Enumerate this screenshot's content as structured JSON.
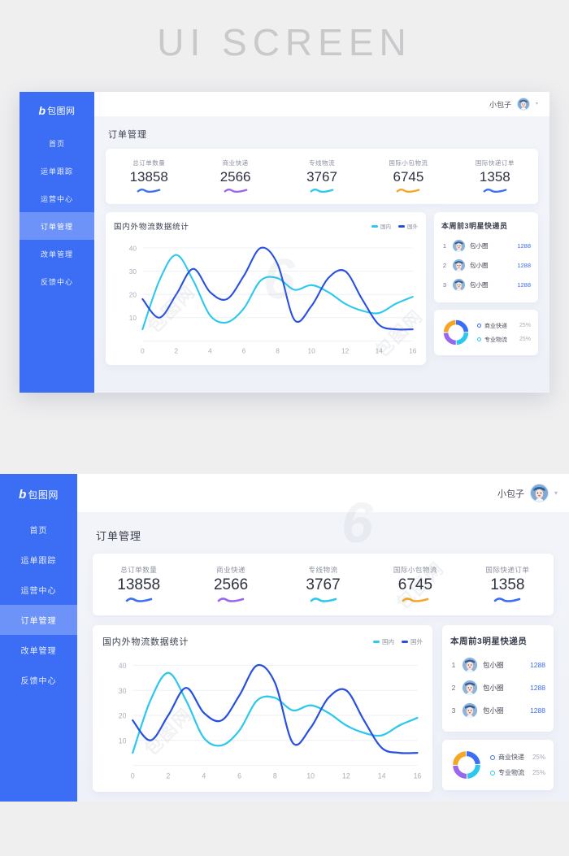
{
  "banner": {
    "text": "UI SCREEN"
  },
  "brand": {
    "mark": "b",
    "name": "包图网"
  },
  "sidebar": {
    "items": [
      {
        "label": "首页",
        "active": false
      },
      {
        "label": "运单跟踪",
        "active": false
      },
      {
        "label": "运营中心",
        "active": false
      },
      {
        "label": "订单管理",
        "active": true
      },
      {
        "label": "改单管理",
        "active": false
      },
      {
        "label": "反馈中心",
        "active": false
      }
    ]
  },
  "topbar": {
    "user_name": "小包子",
    "caret": "▾"
  },
  "page": {
    "title": "订单管理"
  },
  "stats": [
    {
      "label": "总订单数量",
      "value": "13858",
      "color": "#3b6ef5"
    },
    {
      "label": "商业快递",
      "value": "2566",
      "color": "#9966ee"
    },
    {
      "label": "专线物流",
      "value": "3767",
      "color": "#2cc8ee"
    },
    {
      "label": "国际小包物流",
      "value": "6745",
      "color": "#f5a623"
    },
    {
      "label": "国际快递订单",
      "value": "1358",
      "color": "#3b6ef5"
    }
  ],
  "chart_card": {
    "title": "国内外物流数据统计",
    "legend": [
      {
        "label": "国内",
        "color": "#2cc8ee"
      },
      {
        "label": "国外",
        "color": "#2850e0"
      }
    ]
  },
  "chart_data": {
    "type": "line",
    "title": "国内外物流数据统计",
    "xlabel": "",
    "ylabel": "",
    "xlim": [
      0,
      16
    ],
    "ylim": [
      0,
      44
    ],
    "x_ticks": [
      0,
      2,
      4,
      6,
      8,
      10,
      12,
      14,
      16
    ],
    "y_ticks": [
      10,
      20,
      30,
      40
    ],
    "grid": true,
    "legend_position": "top-right",
    "x": [
      0,
      1,
      2,
      3,
      4,
      5,
      6,
      7,
      8,
      9,
      10,
      11,
      12,
      13,
      14,
      15,
      16
    ],
    "series": [
      {
        "name": "国内",
        "color": "#2cc8ee",
        "values": [
          5,
          26,
          37,
          26,
          11,
          8,
          14,
          26,
          27,
          22,
          24,
          21,
          16,
          13,
          12,
          16,
          19
        ]
      },
      {
        "name": "国外",
        "color": "#2850e0",
        "values": [
          18,
          10,
          20,
          31,
          21,
          18,
          28,
          40,
          33,
          9,
          15,
          27,
          30,
          18,
          7,
          5,
          5
        ]
      }
    ]
  },
  "couriers_card": {
    "title": "本周前3明星快递员",
    "rows": [
      {
        "rank": "1",
        "name": "包小圈",
        "score": "1288"
      },
      {
        "rank": "2",
        "name": "包小圈",
        "score": "1288"
      },
      {
        "rank": "3",
        "name": "包小圈",
        "score": "1288"
      }
    ]
  },
  "donut_card": {
    "chart_data": {
      "type": "pie",
      "title": "",
      "labels": [
        "商业快递",
        "专业物流",
        "segment-3",
        "segment-4"
      ],
      "values": [
        25,
        25,
        25,
        25
      ],
      "colors": [
        "#3b6ef5",
        "#2cc8ee",
        "#9966ee",
        "#f5a623"
      ]
    },
    "legend": [
      {
        "label": "商业快递",
        "percent": "25%",
        "color": "#3b6ef5"
      },
      {
        "label": "专业物流",
        "percent": "25%",
        "color": "#2cc8ee"
      }
    ]
  },
  "watermark": {
    "text": "包图网",
    "mark": "6"
  }
}
